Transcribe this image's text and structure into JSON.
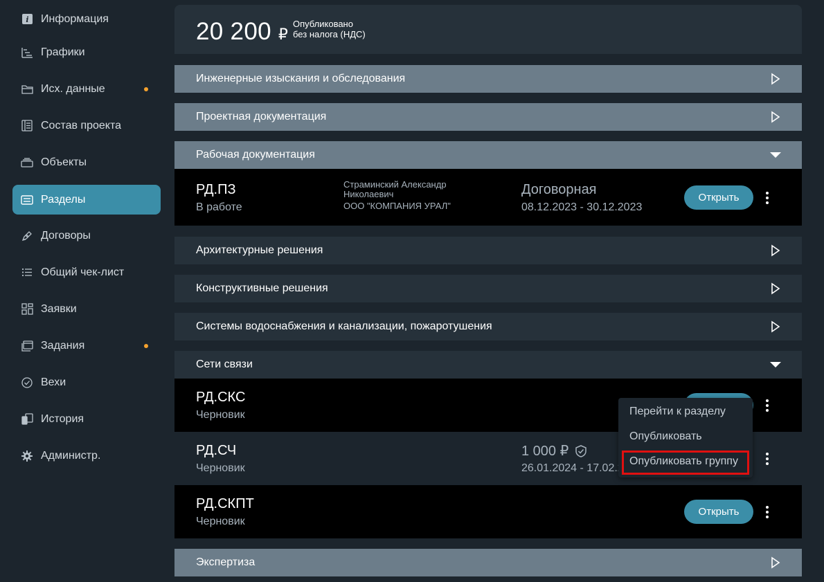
{
  "sidebar": {
    "items": [
      {
        "label": "Информация",
        "icon": "info-icon",
        "dot": false,
        "active": false
      },
      {
        "label": "Графики",
        "icon": "gantt-icon",
        "dot": false,
        "active": false
      },
      {
        "label": "Исх. данные",
        "icon": "folder-icon",
        "dot": true,
        "active": false
      },
      {
        "label": "Состав проекта",
        "icon": "list-doc-icon",
        "dot": false,
        "active": false
      },
      {
        "label": "Объекты",
        "icon": "stack-icon",
        "dot": false,
        "active": false
      },
      {
        "label": "Разделы",
        "icon": "sections-icon",
        "dot": false,
        "active": true
      },
      {
        "label": "Договоры",
        "icon": "pen-icon",
        "dot": false,
        "active": false
      },
      {
        "label": "Общий чек-лист",
        "icon": "checklist-icon",
        "dot": false,
        "active": false
      },
      {
        "label": "Заявки",
        "icon": "grid-icon",
        "dot": false,
        "active": false
      },
      {
        "label": "Задания",
        "icon": "tasks-icon",
        "dot": true,
        "active": false
      },
      {
        "label": "Вехи",
        "icon": "check-circle-icon",
        "dot": false,
        "active": false
      },
      {
        "label": "История",
        "icon": "history-icon",
        "dot": false,
        "active": false
      },
      {
        "label": "Администр.",
        "icon": "gear-icon",
        "dot": false,
        "active": false
      }
    ],
    "dot_color": "#f5a22e",
    "active_color": "#3b8ea8"
  },
  "summary": {
    "amount": "20 200",
    "currency": "₽",
    "status": "Опубликовано",
    "tax_note": "без налога (НДС)"
  },
  "groups": {
    "g1": "Инженерные изыскания и обследования",
    "g2": "Проектная документация",
    "g3": "Рабочая документация",
    "g4": "Архитектурные решения",
    "g5": "Конструктивные решения",
    "g6": "Системы водоснабжения и канализации, пожаротушения",
    "g7": "Сети связи",
    "g8": "Экспертиза"
  },
  "rows": {
    "rd_pz": {
      "code": "РД.ПЗ",
      "status": "В работе",
      "person_line1": "Страминский Александр",
      "person_line2": "Николаевич",
      "company": "ООО \"КОМПАНИЯ УРАЛ\"",
      "type": "Договорная",
      "dates": "08.12.2023 - 30.12.2023",
      "button": "Открыть"
    },
    "rd_sks": {
      "code": "РД.СКС",
      "status": "Черновик"
    },
    "rd_sch": {
      "code": "РД.СЧ",
      "status": "Черновик",
      "price": "1 000 ₽",
      "dates": "26.01.2024 - 17.02.2"
    },
    "rd_skpt": {
      "code": "РД.СКПТ",
      "status": "Черновик",
      "button": "Открыть"
    }
  },
  "context_menu": {
    "items": [
      "Перейти к разделу",
      "Опубликовать",
      "Опубликовать группу"
    ],
    "highlighted": "Опубликовать группу",
    "highlight_color": "#e01010"
  }
}
